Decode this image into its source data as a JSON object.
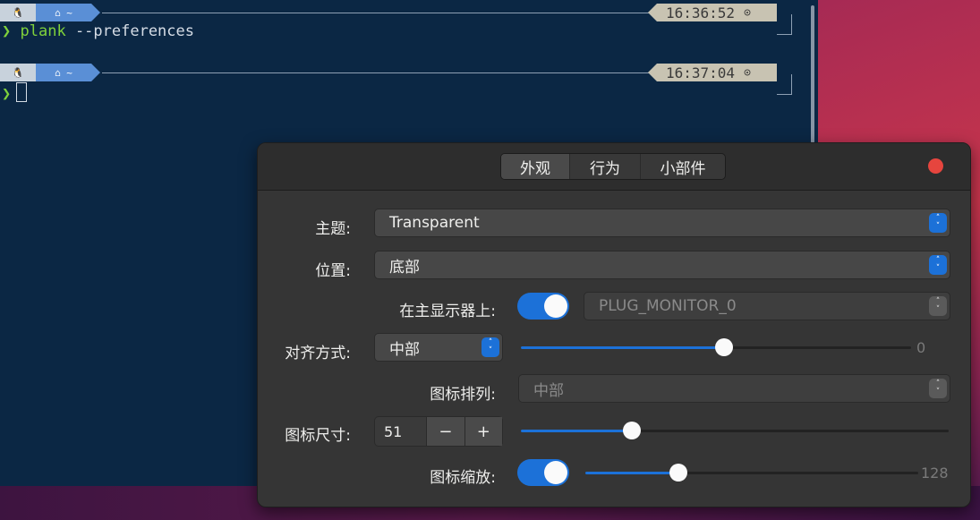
{
  "terminal": {
    "prompt1": {
      "os_icon": "tux-icon",
      "dir_label": "⌂ ~",
      "time": "16:36:52",
      "clock_icon": "⊙"
    },
    "command_chevron": "❯",
    "command_name": "plank",
    "command_args": "--preferences",
    "prompt2": {
      "os_icon": "tux-icon",
      "dir_label": "⌂ ~",
      "time": "16:37:04",
      "clock_icon": "⊙"
    },
    "prompt2_chevron": "❯"
  },
  "dialog": {
    "tabs": [
      {
        "label": "外观",
        "active": true
      },
      {
        "label": "行为",
        "active": false
      },
      {
        "label": "小部件",
        "active": false
      }
    ],
    "close_color": "#e6453e",
    "accent": "#1c71d8",
    "theme": {
      "label": "主题:",
      "value": "Transparent"
    },
    "position": {
      "label": "位置:",
      "value": "底部"
    },
    "monitor": {
      "label": "在主显示器上:",
      "switch_on": true,
      "value": "PLUG_MONITOR_0"
    },
    "alignment": {
      "label": "对齐方式:",
      "value": "中部",
      "offset_value": "0",
      "offset_fraction": 0.52
    },
    "icon_arrangement": {
      "label": "图标排列:",
      "value": "中部"
    },
    "icon_size": {
      "label": "图标尺寸:",
      "value": "51",
      "minus": "−",
      "plus": "+",
      "fraction": 0.26
    },
    "icon_zoom": {
      "label": "图标缩放:",
      "switch_on": true,
      "value": "128",
      "fraction": 0.28
    }
  }
}
